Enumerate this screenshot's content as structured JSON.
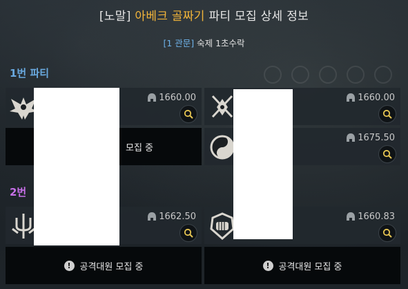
{
  "header": {
    "prefix": "[노말]",
    "raid_name": "아베크 골짜기",
    "suffix": "파티 모집 상세 정보",
    "subtitle_tag": "[1 관문]",
    "subtitle_text": "숙제 1초수락"
  },
  "parties": [
    {
      "label": "1번 파티"
    },
    {
      "label": "2번"
    }
  ],
  "slots": [
    {
      "score": "1660.00",
      "emblem": "demon-wing-icon"
    },
    {
      "score": "1660.00",
      "emblem": "crossed-swords-crest-icon"
    },
    {
      "score": "1675.50",
      "emblem": "yin-yang-icon"
    },
    {
      "score": "1662.50",
      "emblem": "trident-crest-icon"
    },
    {
      "score": "1660.83",
      "emblem": "fist-shield-icon"
    }
  ],
  "recruit": {
    "partial_text": "모집 중",
    "full_text": "공격대원 모집 중"
  },
  "colors": {
    "raid_name": "#f1b43a",
    "party1": "#69a9df",
    "party2": "#c770e8",
    "subtitle_tag": "#6fb3ea"
  }
}
